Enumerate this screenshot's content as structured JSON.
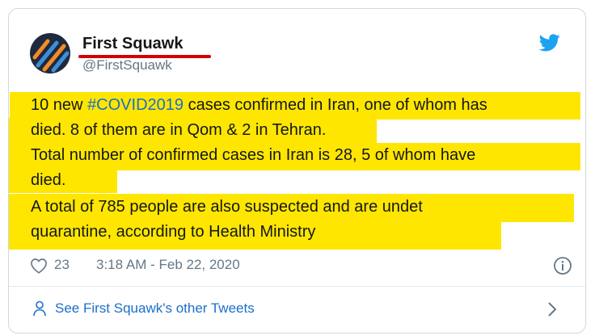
{
  "tweet": {
    "author_name": "First Squawk",
    "author_handle": "@FirstSquawk",
    "lines": {
      "l1_pre": "10 new ",
      "l1_hashtag": "#COVID2019",
      "l1_post": " cases confirmed in Iran, one of whom has",
      "l2": "died. 8 of them are in Qom & 2 in Tehran.",
      "l3": "Total number of confirmed cases in Iran is 28, 5 of whom have",
      "l4": "died.",
      "l5": "A total of 785 people are also suspected and are undet",
      "l6": "quarantine, according to Health Ministry"
    },
    "likes": "23",
    "timestamp": "3:18 AM - Feb 22, 2020"
  },
  "footer": {
    "link_label": "See First Squawk's other Tweets"
  },
  "colors": {
    "highlight": "#ffe600",
    "link": "#1b6fc9",
    "twitter_blue": "#1da1f2",
    "underline_red": "#d40000"
  },
  "icons": {
    "avatar": "first-squawk-logo",
    "brand": "twitter-bird-icon",
    "like": "heart-icon",
    "info": "info-icon",
    "profile": "person-icon",
    "chevron": "chevron-right-icon"
  }
}
